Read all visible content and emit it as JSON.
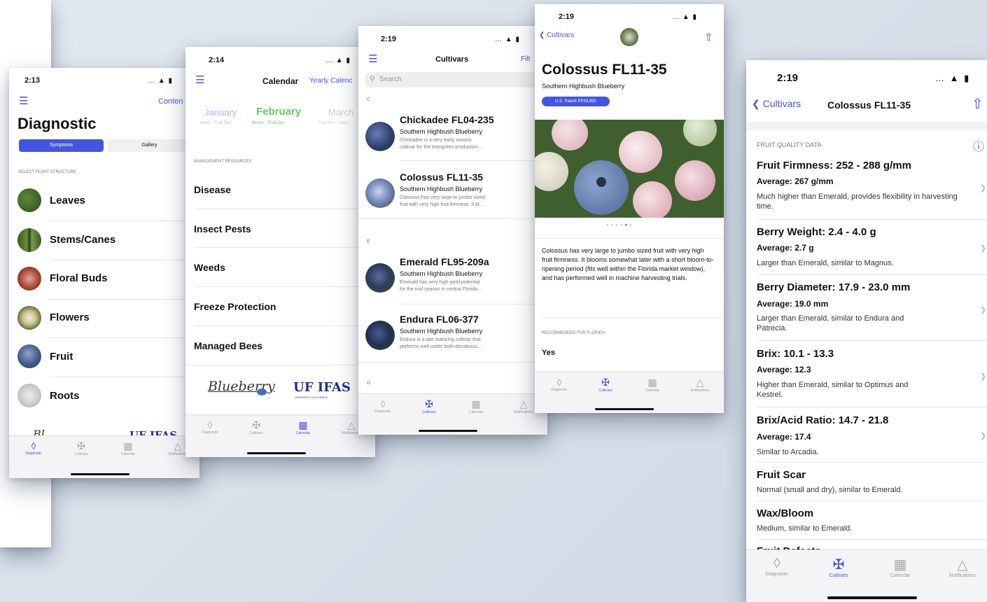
{
  "diagnostic": {
    "time": "2:13",
    "status_icons": "… ▲ ▮",
    "content_link": "Conten",
    "title": "Diagnostic",
    "segments": [
      "Symptoms",
      "Gallery"
    ],
    "section_label": "SELECT PLANT STRUCTURE",
    "items": [
      "Leaves",
      "Stems/Canes",
      "Floral Buds",
      "Flowers",
      "Fruit",
      "Roots"
    ],
    "footer_logo": "Bl...",
    "footer_uf": "UF IFAS"
  },
  "calendar": {
    "time": "2:14",
    "status_icons": "… ▲ ▮",
    "title": "Calendar",
    "link": "Yearly Calenc",
    "months": [
      {
        "name": "January",
        "sub": "Dorm - Fruit Dev"
      },
      {
        "name": "February",
        "sub": "Bloom - Fruit Dev"
      },
      {
        "name": "March",
        "sub": "Fruit Dev - Harv"
      }
    ],
    "section_label": "MANAGEMENT RESOURCES",
    "items": [
      "Disease",
      "Insect Pests",
      "Weeds",
      "Freeze Protection",
      "Managed Bees"
    ],
    "logo_blueberry": "Blueberry",
    "logo_uf": "UF IFAS",
    "logo_uf_sub": "UNIVERSITY of FLORIDA"
  },
  "cultivars": {
    "time": "2:19",
    "status_icons": "… ▲ ▮",
    "title": "Cultivars",
    "filter": "Filt",
    "search_placeholder": "Search",
    "index_c": "C",
    "index_e": "E",
    "index_g": "G",
    "items": [
      {
        "name": "Chickadee FL04-235",
        "type": "Southern Highbush Blueberry",
        "desc1": "Chickadee is a very early season",
        "desc2": "cultivar for the evergreen production..."
      },
      {
        "name": "Colossus FL11-35",
        "type": "Southern Highbush Blueberry",
        "desc1": "Colossus has very large to jumbo sized",
        "desc2": "fruit with very high fruit firmness. It bl..."
      },
      {
        "name": "Emerald FL95-209a",
        "type": "Southern Highbush Blueberry",
        "desc1": "Emerald has very high yield potential",
        "desc2": "for the mid season in central Florida..."
      },
      {
        "name": "Endura FL06-377",
        "type": "Southern Highbush Blueberry",
        "desc1": "Endura is a late maturing cultivar that",
        "desc2": "performs well under both deciduous..."
      }
    ]
  },
  "detail": {
    "time": "2:19",
    "status_icons": "… ▲ ▮",
    "back": "Cultivars",
    "title": "Colossus FL11-35",
    "subtitle": "Southern Highbush Blueberry",
    "badge": "U.S. Patent PP33,892",
    "description": "Colossus has very large to jumbo sized fruit with very high fruit firmness. It blooms somewhat later with a short bloom-to-ripening period (fits well within the Florida market window), and has performed well in machine harvesting trials.",
    "recommended_label": "RECOMMENDED FOR FLORIDA",
    "recommended_value": "Yes"
  },
  "quality": {
    "time": "2:19",
    "status_icons": "… ▲ ▮",
    "back": "Cultivars",
    "title": "Colossus FL11-35",
    "section_label": "FRUIT QUALITY DATA",
    "rows": [
      {
        "title": "Fruit Firmness: 252 - 288 g/mm",
        "avg": "Average: 267 g/mm",
        "note": "Much higher than Emerald, provides flexibility in harvesting time."
      },
      {
        "title": "Berry Weight: 2.4 - 4.0 g",
        "avg": "Average: 2.7 g",
        "note": "Larger than Emerald, similar to Magnus."
      },
      {
        "title": "Berry Diameter: 17.9 - 23.0 mm",
        "avg": "Average: 19.0 mm",
        "note": "Larger than Emerald, similar to Endura and Patrecia."
      },
      {
        "title": "Brix: 10.1 - 13.3",
        "avg": "Average: 12.3",
        "note": "Higher than Emerald, similar to Optimus and Kestrel."
      },
      {
        "title": "Brix/Acid Ratio: 14.7 - 21.8",
        "avg": "Average: 17.4",
        "note": "Similar to Arcadia."
      },
      {
        "title": "Fruit Scar",
        "avg": "",
        "note": "Normal (small and dry), similar to Emerald."
      },
      {
        "title": "Wax/Bloom",
        "avg": "",
        "note": "Medium, similar to Emerald."
      },
      {
        "title": "Fruit Defects",
        "avg": "",
        "note": ""
      }
    ]
  },
  "tabs": [
    "Diagnostic",
    "Cultivars",
    "Calendar",
    "Notifications"
  ],
  "colors": {
    "accent": "#4455dd",
    "background": "#dde4ed"
  }
}
